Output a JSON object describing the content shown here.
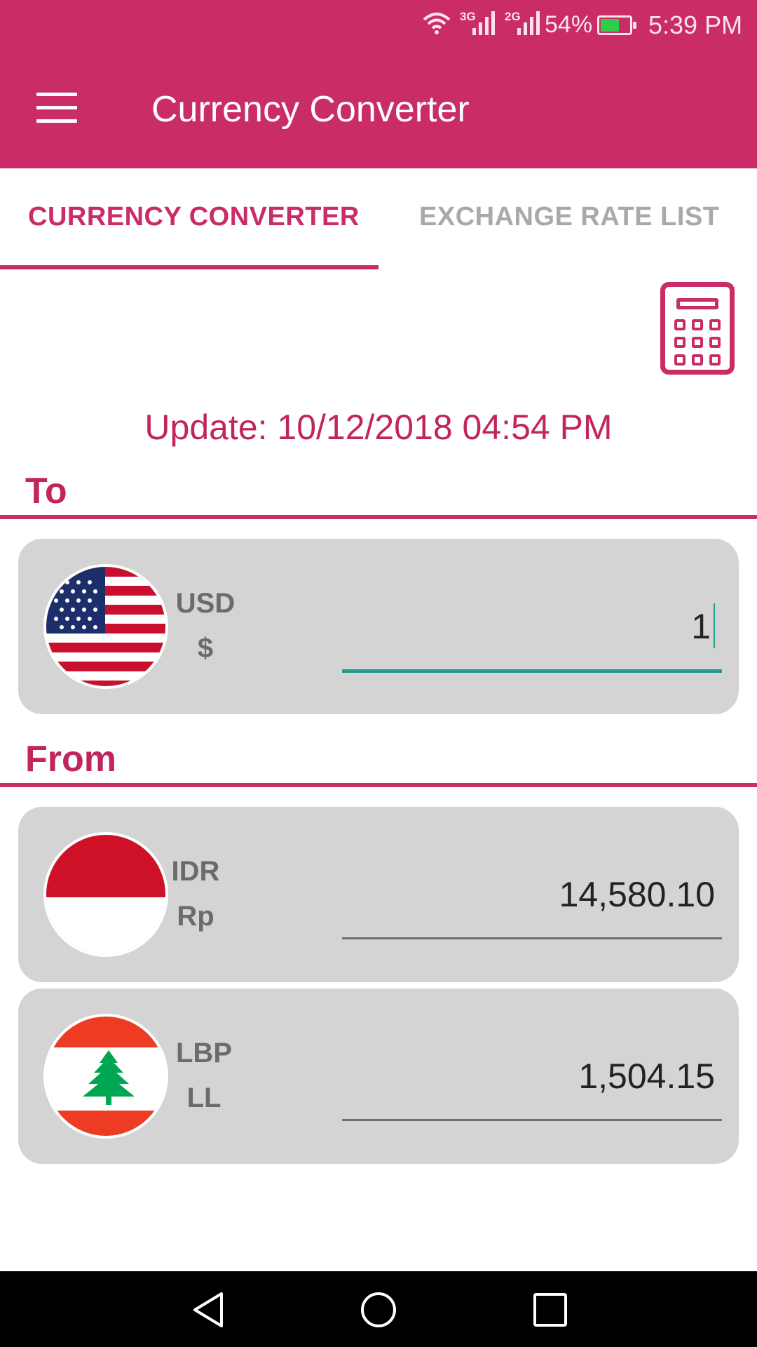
{
  "status_bar": {
    "network_1": "3G",
    "network_2": "2G",
    "battery": "54%",
    "time": "5:39 PM"
  },
  "app_bar": {
    "title": "Currency Converter"
  },
  "tabs": [
    {
      "label": "CURRENCY CONVERTER",
      "selected": true
    },
    {
      "label": "EXCHANGE RATE LIST",
      "selected": false
    }
  ],
  "update_text": "Update: 10/12/2018 04:54 PM",
  "to_section": {
    "label": "To",
    "currency": {
      "code": "USD",
      "symbol": "$",
      "amount": "1",
      "flag": "us-flag"
    }
  },
  "from_section": {
    "label": "From",
    "currencies": [
      {
        "code": "IDR",
        "symbol": "Rp",
        "amount": "14,580.10",
        "flag": "indonesia-flag"
      },
      {
        "code": "LBP",
        "symbol": "LL",
        "amount": "1,504.15",
        "flag": "lebanon-flag"
      }
    ]
  },
  "colors": {
    "primary": "#c92c66",
    "accent_underline": "#1f9c8a",
    "card_background": "#d4d4d4",
    "inactive_tab": "#a9a9a9"
  }
}
